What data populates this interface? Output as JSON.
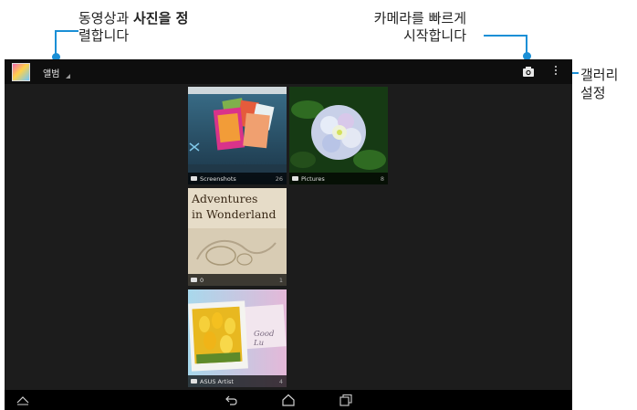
{
  "callouts": {
    "sort": {
      "part1": "동영상과 ",
      "bold1": "사진을 정",
      "line2": "렬합니다"
    },
    "camera": {
      "line1": "카메라를 빠르게",
      "line2": "시작합니다"
    },
    "settings": {
      "line1": "갤러리",
      "line2": "설정"
    }
  },
  "actionbar": {
    "album_label": "앨범"
  },
  "albums": [
    {
      "name": "Screenshots",
      "count": "26"
    },
    {
      "name": "Pictures",
      "count": "8"
    },
    {
      "name": "0",
      "count": "1"
    },
    {
      "name": "ASUS Artist",
      "count": "4"
    }
  ],
  "wonderland": {
    "line1": "Adventures",
    "line2": "in Wonderland"
  },
  "card_text": "Good Lu",
  "icons": {
    "app": "gallery-app-icon",
    "camera": "camera-icon",
    "menu": "overflow-menu-icon",
    "folder": "folder-icon",
    "nav_recent": "collapse-icon",
    "nav_back": "back-icon",
    "nav_home": "home-icon",
    "nav_recents": "recent-apps-icon"
  },
  "colors": {
    "accent": "#1a8fd6",
    "screen_bg": "#1c1c1c",
    "bar_bg": "#0e0e0e"
  }
}
